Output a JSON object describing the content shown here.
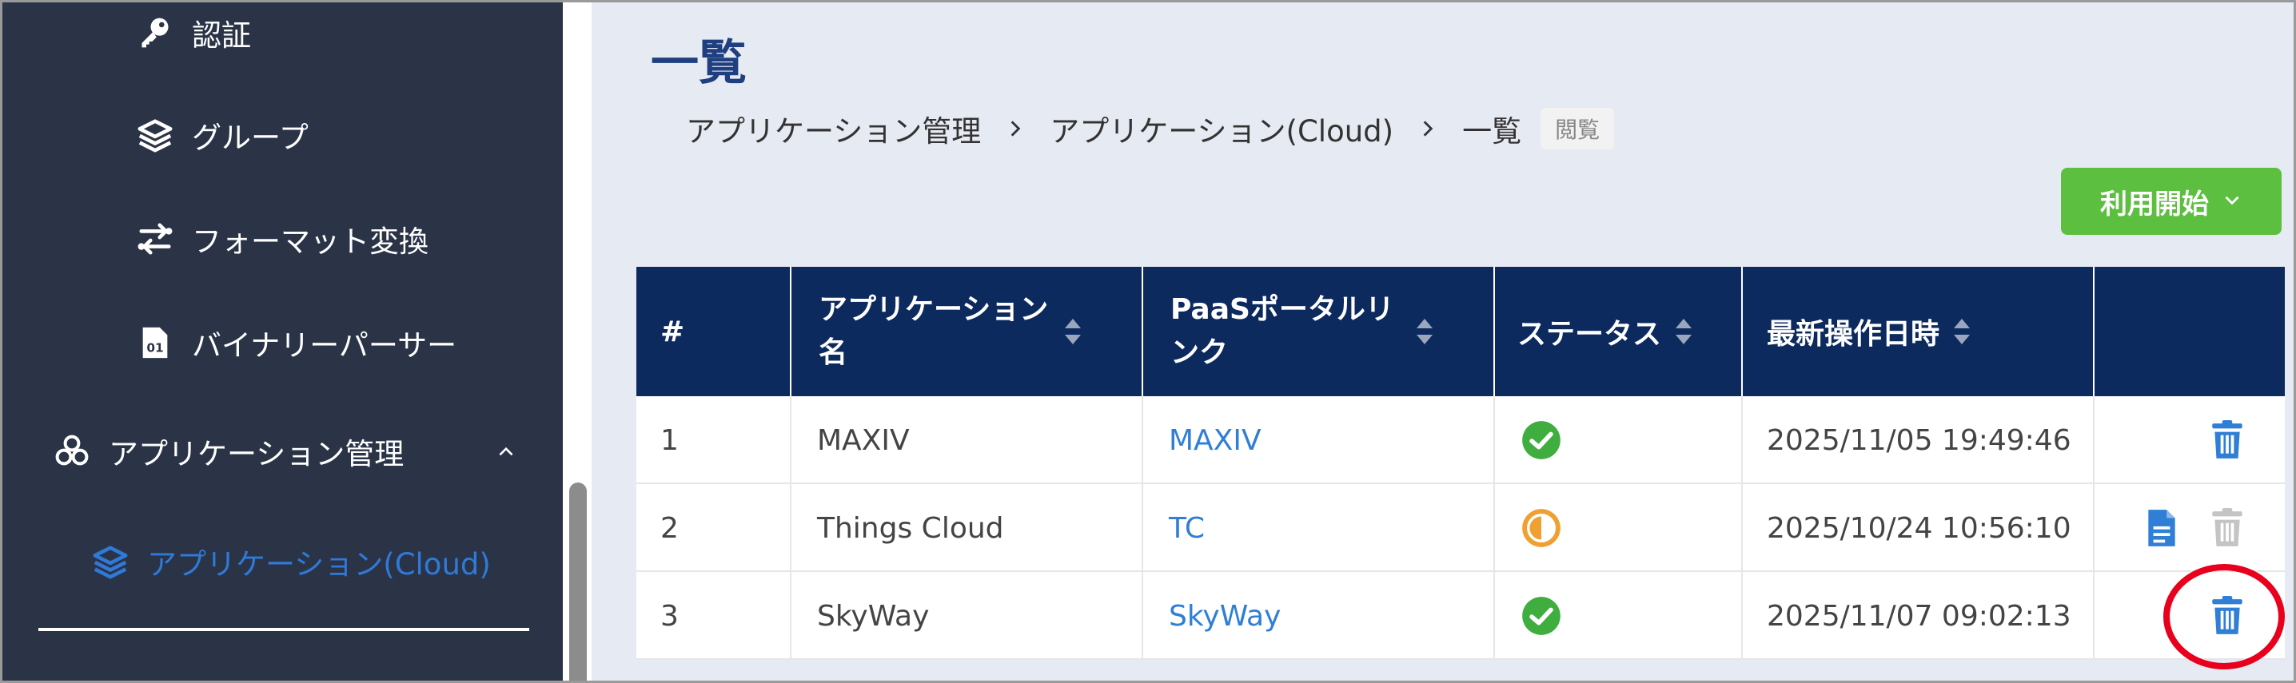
{
  "sidebar": {
    "items": [
      {
        "label": "認証",
        "icon": "key-icon"
      },
      {
        "label": "グループ",
        "icon": "layers-icon"
      },
      {
        "label": "フォーマット変換",
        "icon": "swap-icon"
      },
      {
        "label": "バイナリーパーサー",
        "icon": "binary-file-icon"
      },
      {
        "label": "アプリケーション管理",
        "icon": "apps-icon"
      },
      {
        "label": "アプリケーション(Cloud)",
        "icon": "layers-icon"
      }
    ],
    "active_color": "#2f79d8"
  },
  "page": {
    "title": "一覧",
    "breadcrumb": [
      "アプリケーション管理",
      "アプリケーション(Cloud)",
      "一覧"
    ],
    "badge": "閲覧",
    "start_button": "利用開始"
  },
  "table": {
    "headers": [
      "#",
      "アプリケーション名",
      "PaaSポータルリンク",
      "ステータス",
      "最新操作日時",
      ""
    ],
    "rows": [
      {
        "num": "1",
        "name": "MAXIV",
        "link": "MAXIV",
        "status": "ok",
        "datetime": "2025/11/05 19:49:46",
        "has_doc": false,
        "delete_enabled": true
      },
      {
        "num": "2",
        "name": "Things Cloud",
        "link": "TC",
        "status": "partial",
        "datetime": "2025/10/24 10:56:10",
        "has_doc": true,
        "delete_enabled": false
      },
      {
        "num": "3",
        "name": "SkyWay",
        "link": "SkyWay",
        "status": "ok",
        "datetime": "2025/11/07 09:02:13",
        "has_doc": false,
        "delete_enabled": true
      }
    ]
  },
  "colors": {
    "header_bg": "#0d2a5e",
    "title": "#1f3f80",
    "link": "#2f7fd6",
    "success": "#3fae3f",
    "warning": "#f0a030",
    "button_green": "#5cbf3f",
    "highlight": "#e8001c"
  }
}
